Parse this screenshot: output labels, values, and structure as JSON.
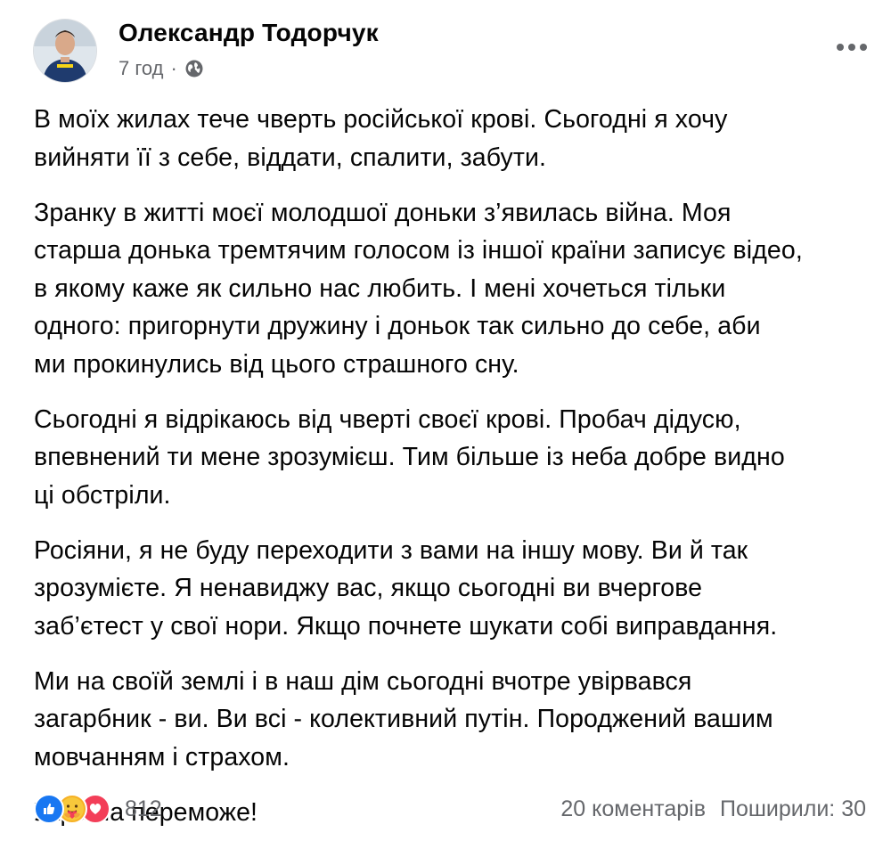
{
  "post": {
    "author": "Олександр Тодорчук",
    "time": "7 год",
    "separator": "·",
    "privacy_icon": "globe-icon",
    "more_icon": "more-horizontal-icon",
    "paragraphs": [
      "В моїх жилах тече чверть російської крові. Сьогодні я хочу\nвийняти її з себе, віддати, спалити, забути.",
      "Зранку в житті моєї молодшої доньки з’явилась війна. Моя\nстарша донька тремтячим голосом із іншої країни записує відео,\nв якому каже як сильно нас любить. І мені хочеться тільки\nодного: пригорнути дружину і доньок так сильно до себе, аби\nми прокинулись від цього страшного сну.",
      "Сьогодні я відрікаюсь від чверті своєї крові. Пробач дідусю,\nвпевнений ти мене зрозумієш. Тим більше із неба добре видно\nці обстріли.",
      "Росіяни, я не буду переходити з вами на іншу мову. Ви й так\nзрозумієте. Я ненавиджу вас, якщо сьогодні ви вчергове\nзаб’єтест у свої нори. Якщо почнете шукати собі виправдання.",
      "Ми на своїй землі і в наш дім сьогодні вчотре увірвався\nзагарбник - ви. Ви всі - колективний путін. Породжений вашим\nмовчанням і страхом.",
      "Україна переможе!"
    ],
    "reactions": {
      "icons": [
        "like-icon",
        "care-icon",
        "love-icon"
      ],
      "count": "812"
    },
    "comments": "20 коментарів",
    "shares": "Поширили: 30",
    "colors": {
      "like": "#1877f2",
      "love": "#f33e58",
      "care": "#f7b125",
      "secondary_text": "#65676b"
    }
  }
}
